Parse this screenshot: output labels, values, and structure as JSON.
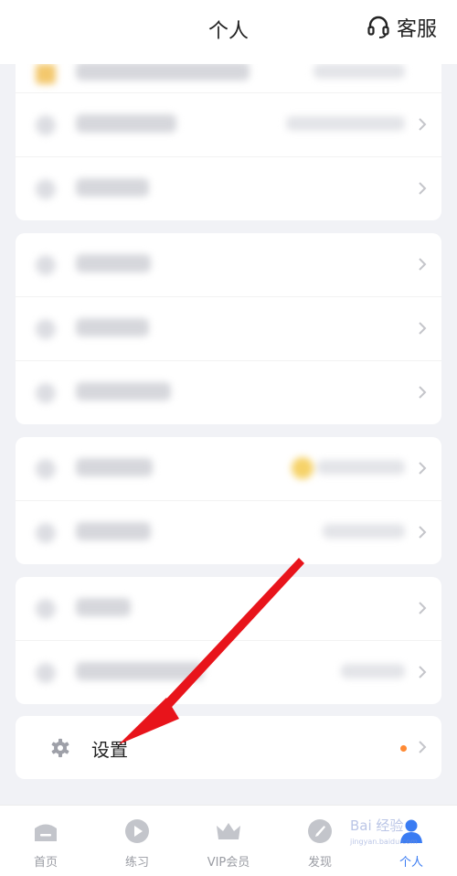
{
  "header": {
    "title": "个人",
    "service_label": "客服"
  },
  "settings": {
    "label": "设置"
  },
  "tabs": [
    {
      "label": "首页",
      "icon": "home-icon"
    },
    {
      "label": "练习",
      "icon": "play-icon"
    },
    {
      "label": "VIP会员",
      "icon": "crown-icon"
    },
    {
      "label": "发现",
      "icon": "compass-icon"
    },
    {
      "label": "个人",
      "icon": "person-icon",
      "active": true
    }
  ],
  "watermark": {
    "text": "Bai 经验",
    "sub": "jingyan.baidu.com"
  },
  "colors": {
    "accent": "#3a7cf3",
    "arrow": "#e8141b",
    "badge": "#ff8a33"
  }
}
